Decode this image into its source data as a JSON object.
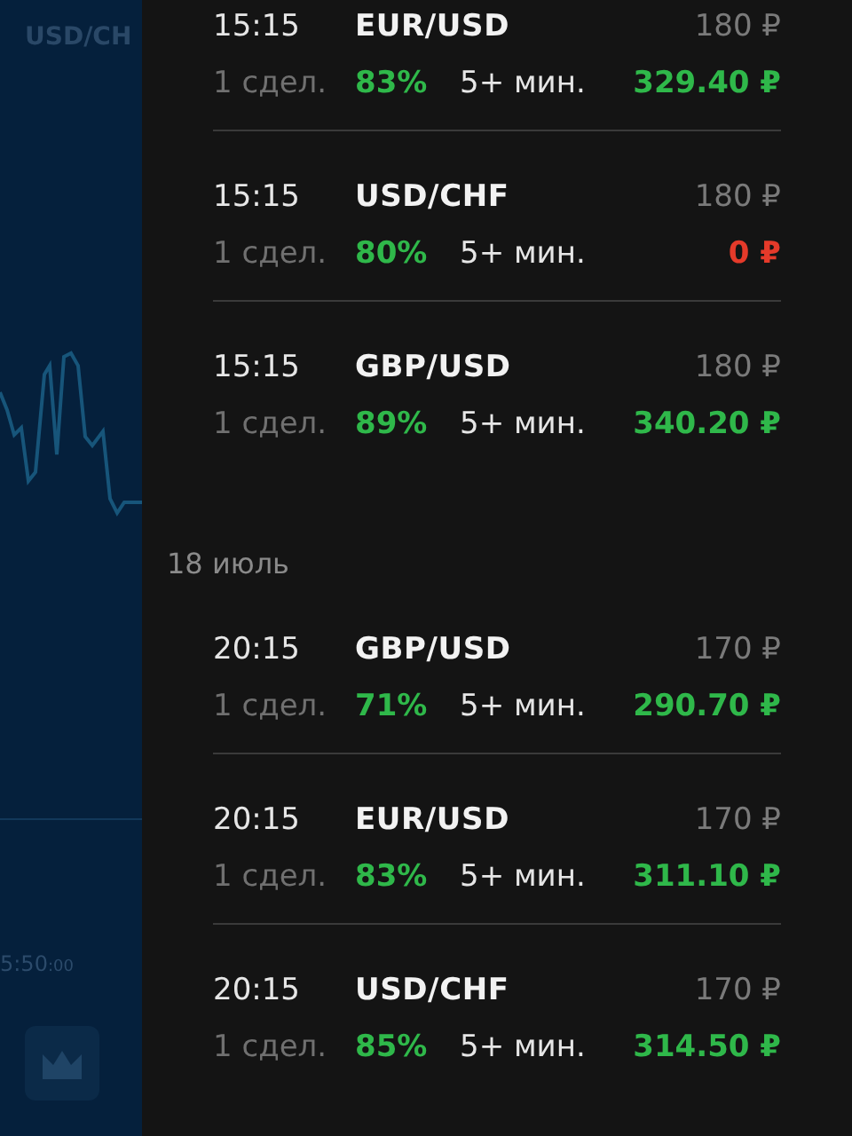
{
  "chart_panel": {
    "title": "USD/CH",
    "time": "5:50",
    "time_seconds": ":00"
  },
  "groups": [
    {
      "trades": [
        {
          "time": "15:15",
          "pair": "EUR/USD",
          "stake": "180 ₽",
          "count": "1 сдел.",
          "percent": "83%",
          "duration": "5+ мин.",
          "result": "329.40 ₽",
          "color": "#2fb84a"
        },
        {
          "time": "15:15",
          "pair": "USD/CHF",
          "stake": "180 ₽",
          "count": "1 сдел.",
          "percent": "80%",
          "duration": "5+ мин.",
          "result": "0 ₽",
          "color": "#e53a2a"
        },
        {
          "time": "15:15",
          "pair": "GBP/USD",
          "stake": "180 ₽",
          "count": "1 сдел.",
          "percent": "89%",
          "duration": "5+ мин.",
          "result": "340.20 ₽",
          "color": "#2fb84a"
        }
      ]
    },
    {
      "date": "18 июль",
      "trades": [
        {
          "time": "20:15",
          "pair": "GBP/USD",
          "stake": "170 ₽",
          "count": "1 сдел.",
          "percent": "71%",
          "duration": "5+ мин.",
          "result": "290.70 ₽",
          "color": "#2fb84a"
        },
        {
          "time": "20:15",
          "pair": "EUR/USD",
          "stake": "170 ₽",
          "count": "1 сдел.",
          "percent": "83%",
          "duration": "5+ мин.",
          "result": "311.10 ₽",
          "color": "#2fb84a"
        },
        {
          "time": "20:15",
          "pair": "USD/CHF",
          "stake": "170 ₽",
          "count": "1 сдел.",
          "percent": "85%",
          "duration": "5+ мин.",
          "result": "314.50 ₽",
          "color": "#2fb84a"
        }
      ]
    }
  ]
}
